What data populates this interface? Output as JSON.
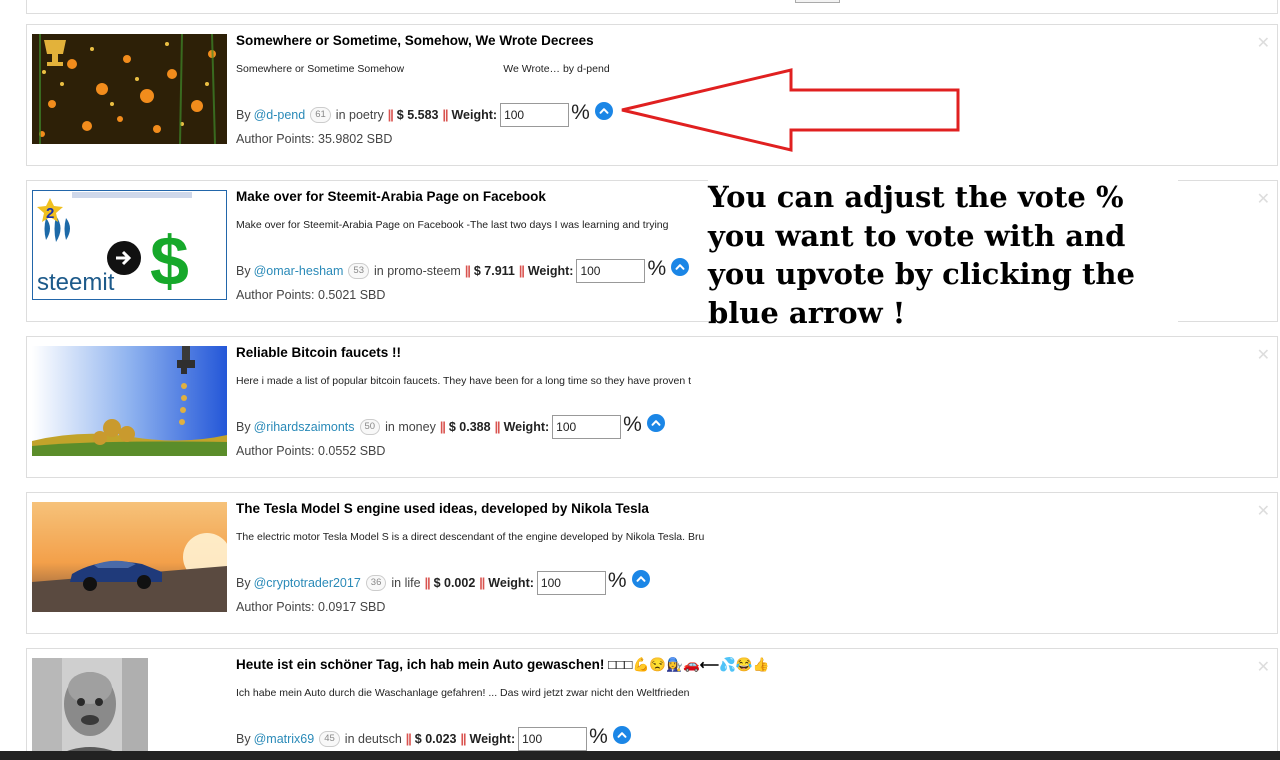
{
  "posts": [
    {
      "title": "Somewhere or Sometime, Somehow, We Wrote Decrees",
      "excerpt": "Somewhere or Sometime Somehow                                  We Wrote… by d-pend",
      "by": "By",
      "author": "@d-pend",
      "reputation": "61",
      "category_prefix": "in",
      "category": "poetry",
      "separator": "||",
      "payout": "$ 5.583",
      "weight_label": "Weight:",
      "weight_value": "100",
      "percent": "%",
      "author_points": "Author Points: 35.9802 SBD",
      "close": "✕"
    },
    {
      "title": "Make over for Steemit-Arabia Page on Facebook",
      "excerpt": "Make over for Steemit-Arabia Page on Facebook -The last two days I was learning and trying",
      "by": "By",
      "author": "@omar-hesham",
      "reputation": "53",
      "category_prefix": "in",
      "category": "promo-steem",
      "separator": "||",
      "payout": "$ 7.911",
      "weight_label": "Weight:",
      "weight_value": "100",
      "percent": "%",
      "author_points": "Author Points: 0.5021 SBD",
      "close": "✕",
      "thumb_text": "steemit",
      "thumb_badge": "2",
      "thumb_symbol": "$"
    },
    {
      "title": "Reliable Bitcoin faucets !!",
      "excerpt": "Here i made a list of popular bitcoin faucets. They have been for a long time so they have proven t",
      "by": "By",
      "author": "@rihardszaimonts",
      "reputation": "50",
      "category_prefix": "in",
      "category": "money",
      "separator": "||",
      "payout": "$ 0.388",
      "weight_label": "Weight:",
      "weight_value": "100",
      "percent": "%",
      "author_points": "Author Points: 0.0552 SBD",
      "close": "✕"
    },
    {
      "title": "The Tesla Model S engine used ideas, developed by Nikola Tesla",
      "excerpt": "The electric motor Tesla Model S is a direct descendant of the engine developed by Nikola Tesla. Bru",
      "by": "By",
      "author": "@cryptotrader2017",
      "reputation": "36",
      "category_prefix": "in",
      "category": "life",
      "separator": "||",
      "payout": "$ 0.002",
      "weight_label": "Weight:",
      "weight_value": "100",
      "percent": "%",
      "author_points": "Author Points: 0.0917 SBD",
      "close": "✕"
    },
    {
      "title": "Heute ist ein schöner Tag, ich hab mein Auto gewaschen! □□□💪😒👩‍🔧🚗⟵💦😂👍",
      "excerpt": "Ich habe mein Auto durch die Waschanlage gefahren! ... Das wird jetzt zwar nicht den Weltfrieden",
      "by": "By",
      "author": "@matrix69",
      "reputation": "45",
      "category_prefix": "in",
      "category": "deutsch",
      "separator": "||",
      "payout": "$ 0.023",
      "weight_label": "Weight:",
      "weight_value": "100",
      "percent": "%",
      "close": "✕"
    }
  ],
  "annotation": {
    "text": "You can adjust the vote % you want to vote with and you upvote by clicking the blue arrow !",
    "arrow_color": "#e02020"
  },
  "colors": {
    "upvote": "#1b86e6",
    "author_link": "#2a8ab8",
    "separator": "#d9534f"
  },
  "icons": {
    "upvote": "chevron-up-icon",
    "close": "close-icon"
  }
}
